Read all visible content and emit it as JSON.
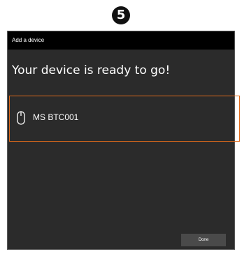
{
  "step_badge": "5",
  "window": {
    "title": "Add a device",
    "heading": "Your device is ready to go!"
  },
  "device": {
    "icon": "mouse-icon",
    "name": "MS BTC001"
  },
  "footer": {
    "done_label": "Done"
  },
  "colors": {
    "window_bg": "#2b2b2b",
    "titlebar_bg": "#000000",
    "highlight": "#e06a1a",
    "button_bg": "#4a4a4a"
  }
}
